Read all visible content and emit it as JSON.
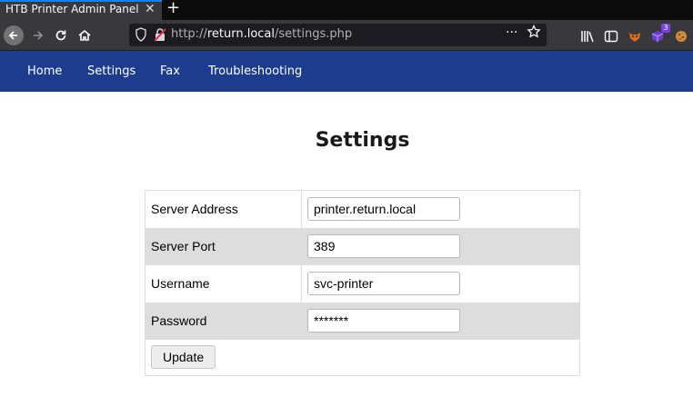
{
  "browser": {
    "tab_title": "HTB Printer Admin Panel",
    "tab_close": "✕",
    "new_tab": "+",
    "url_prefix": "http://",
    "url_host": "return.local",
    "url_path": "/settings.php",
    "url_more": "···",
    "badge_count": "3"
  },
  "nav": {
    "items": [
      "Home",
      "Settings",
      "Fax",
      "Troubleshooting"
    ]
  },
  "page": {
    "title": "Settings"
  },
  "settings": {
    "rows": [
      {
        "label": "Server Address",
        "value": "printer.return.local"
      },
      {
        "label": "Server Port",
        "value": "389"
      },
      {
        "label": "Username",
        "value": "svc-printer"
      },
      {
        "label": "Password",
        "value": "*******"
      }
    ],
    "update_label": "Update"
  }
}
